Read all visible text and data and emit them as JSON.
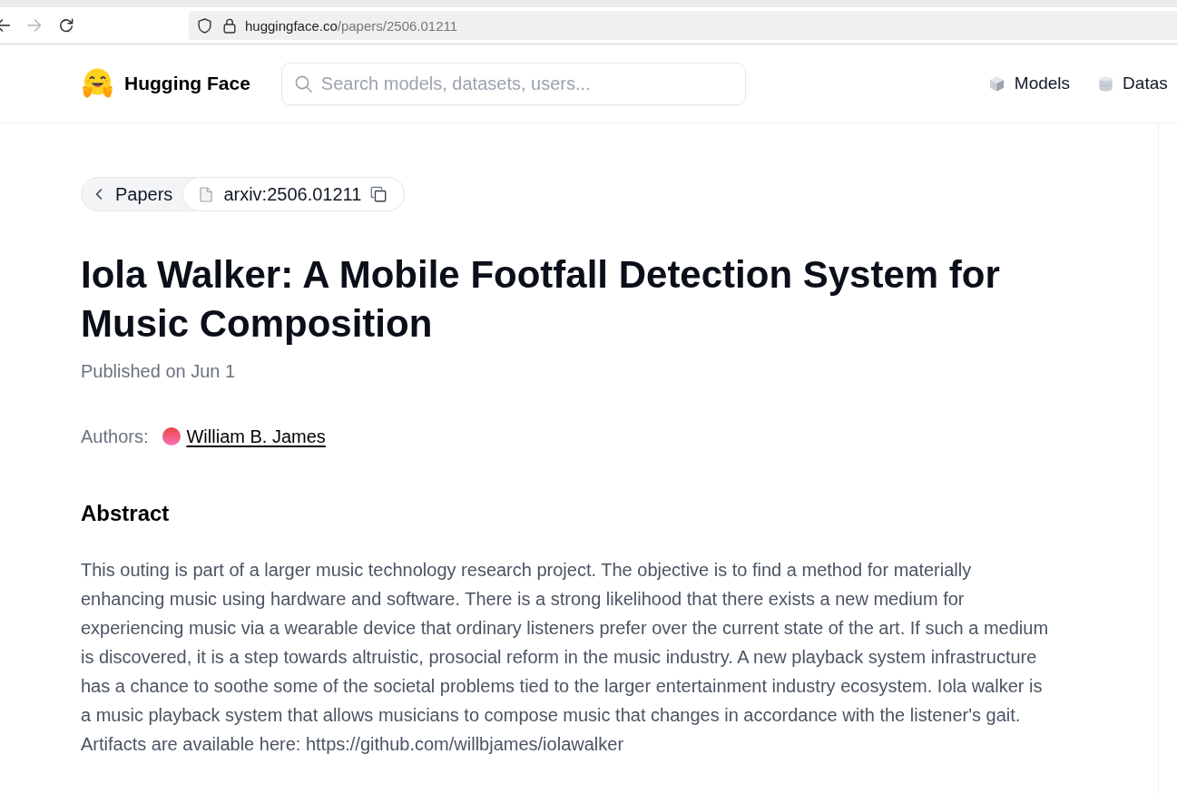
{
  "browser": {
    "buttons": [
      {
        "kind": "back",
        "disabled": false
      },
      {
        "kind": "forward",
        "disabled": true
      },
      {
        "kind": "reload",
        "disabled": false
      }
    ],
    "url_host": "huggingface.co",
    "url_path": "/papers/2506.01211"
  },
  "header": {
    "brand": "Hugging Face",
    "search": {
      "placeholder": "Search models, datasets, users..."
    },
    "nav": [
      {
        "kind": "models",
        "label": "Models"
      },
      {
        "kind": "datasets",
        "label": "Datas"
      }
    ]
  },
  "breadcrumb": {
    "back": "Papers",
    "paper_id": "arxiv:2506.01211"
  },
  "paper": {
    "title": "Iola Walker: A Mobile Footfall Detection System for Music Composition",
    "published": "Published on Jun 1",
    "authors_label": "Authors:",
    "authors": [
      {
        "name": "William B. James"
      }
    ],
    "abstract_heading": "Abstract",
    "abstract": "This outing is part of a larger music technology research project. The objective is to find a method for materially enhancing music using hardware and software. There is a strong likelihood that there exists a new medium for experiencing music via a wearable device that ordinary listeners prefer over the current state of the art. If such a medium is discovered, it is a step towards altruistic, prosocial reform in the music industry. A new playback system infrastructure has a chance to soothe some of the societal problems tied to the larger entertainment industry ecosystem. Iola walker is a music playback system that allows musicians to compose music that changes in accordance with the listener's gait. Artifacts are available here: https://github.com/willbjames/iolawalker"
  }
}
